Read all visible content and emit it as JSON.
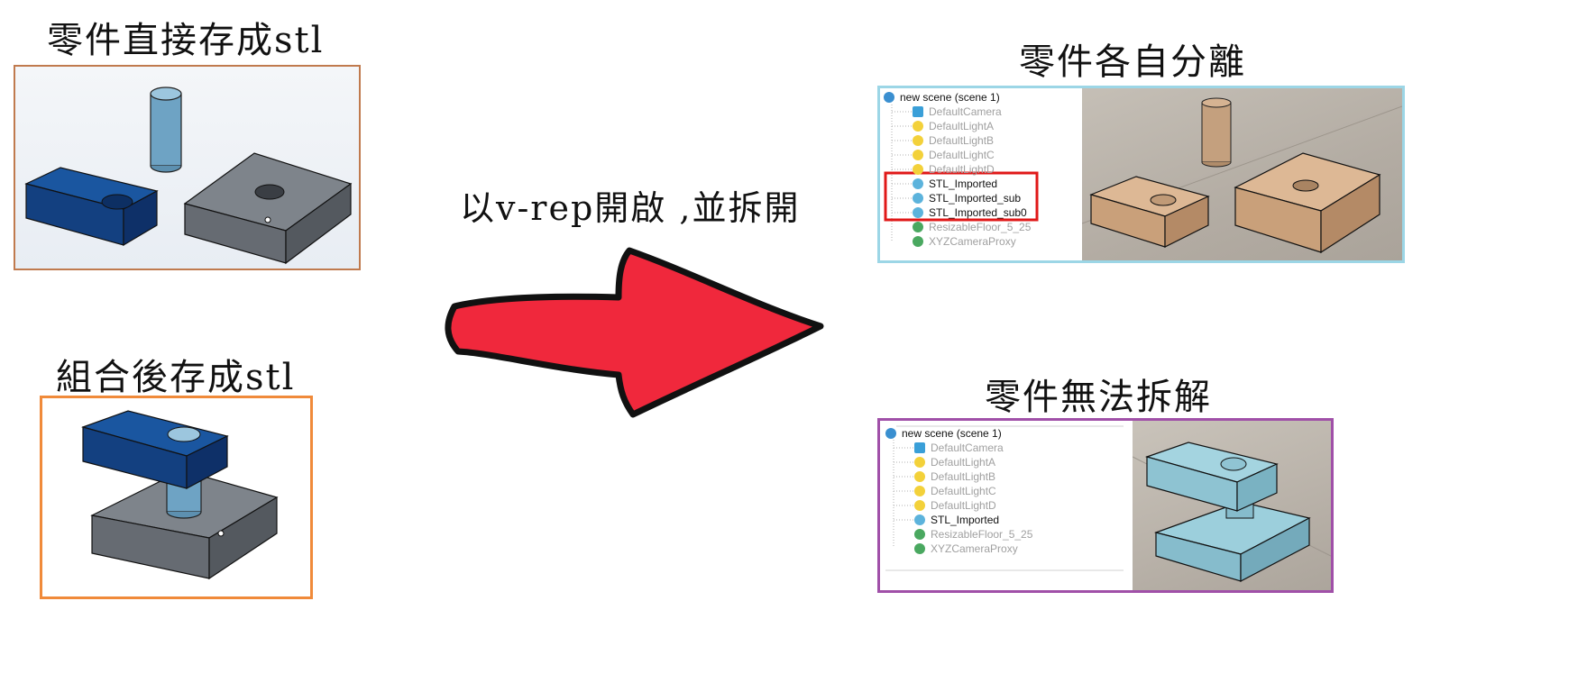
{
  "headings": {
    "top_left": "零件直接存成stl",
    "bottom_left": "組合後存成stl",
    "middle": "以v-rep開啟 ,並拆開",
    "top_right": "零件各自分離",
    "bottom_right": "零件無法拆解"
  },
  "scene_top": {
    "root": "new scene (scene 1)",
    "items": [
      "DefaultCamera",
      "DefaultLightA",
      "DefaultLightB",
      "DefaultLightC",
      "DefaultLightD",
      "STL_Imported",
      "STL_Imported_sub",
      "STL_Imported_sub0",
      "ResizableFloor_5_25",
      "XYZCameraProxy"
    ]
  },
  "scene_bottom": {
    "root": "new scene (scene 1)",
    "items": [
      "DefaultCamera",
      "DefaultLightA",
      "DefaultLightB",
      "DefaultLightC",
      "DefaultLightD",
      "STL_Imported",
      "ResizableFloor_5_25",
      "XYZCameraProxy"
    ]
  },
  "colors": {
    "frame_top_left": "#c07a4e",
    "frame_bottom_left": "#f08a3a",
    "frame_top_right": "#9cd6e6",
    "frame_bottom_right": "#a050a8",
    "arrow": "#f0283c",
    "highlight_box": "#e01818"
  }
}
